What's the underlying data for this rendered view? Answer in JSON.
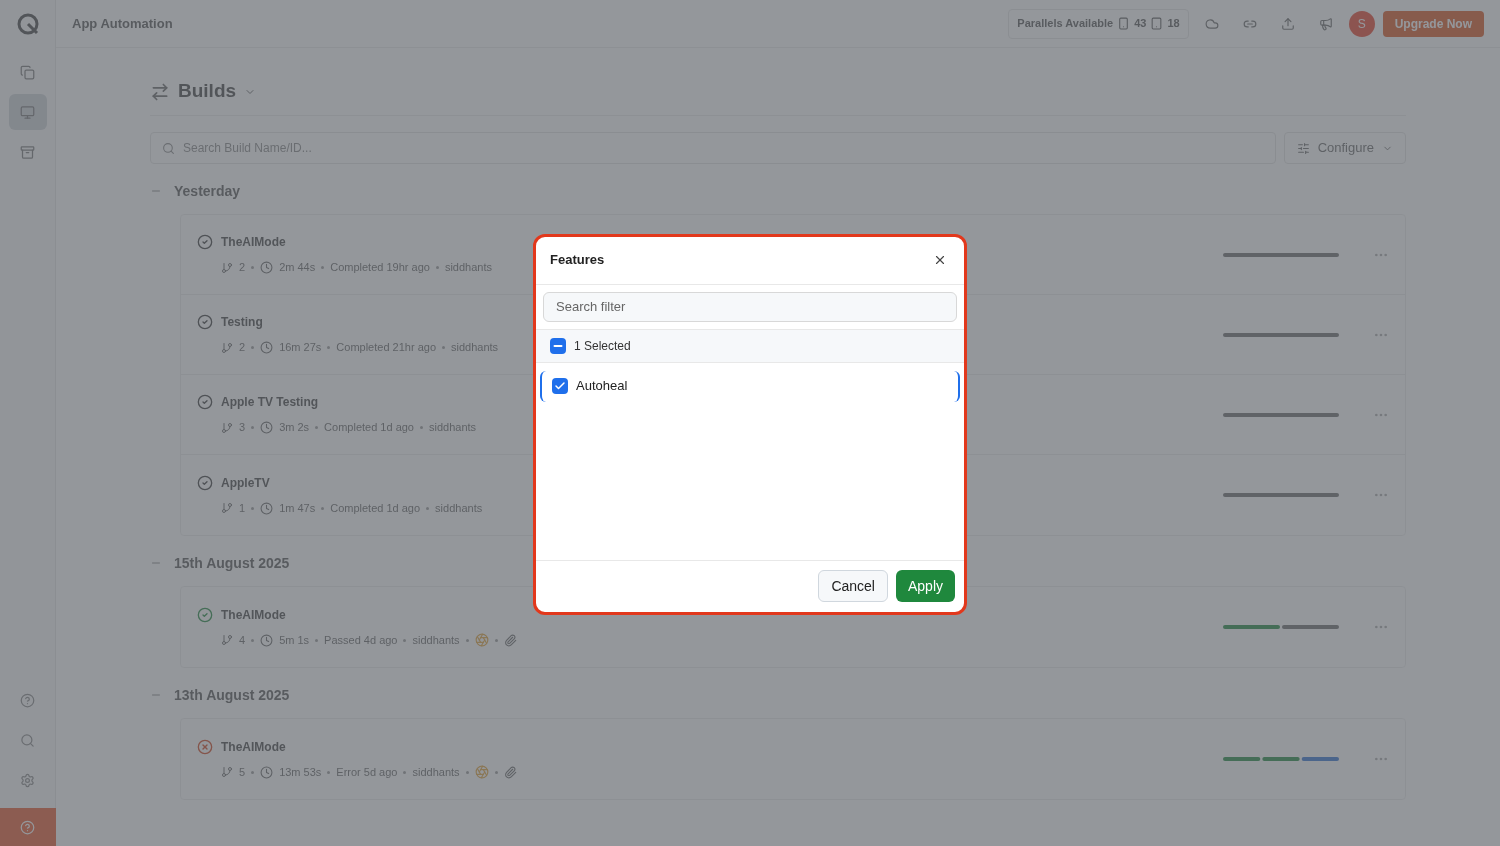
{
  "topbar": {
    "title": "App Automation",
    "parallels_label": "Parallels Available",
    "parallels_mobile": "43",
    "parallels_desktop": "18",
    "avatar": "S",
    "upgrade": "Upgrade Now"
  },
  "sidebar": {
    "items": [
      {
        "kind": "copy",
        "selected": false
      },
      {
        "kind": "device",
        "selected": true
      },
      {
        "kind": "archive",
        "selected": false
      }
    ],
    "bottom": [
      {
        "kind": "help"
      },
      {
        "kind": "search"
      },
      {
        "kind": "settings"
      }
    ]
  },
  "page": {
    "title": "Builds",
    "search": {
      "placeholder": "Search Build Name/ID..."
    },
    "configure": "Configure"
  },
  "groups": [
    {
      "label": "Yesterday",
      "builds": [
        {
          "name": "TheAIMode",
          "kind": "completed",
          "count": "2",
          "duration": "2m 44s",
          "result": "Completed 19hr ago",
          "user": "siddhants",
          "extras": false
        },
        {
          "name": "Testing",
          "kind": "completed",
          "count": "2",
          "duration": "16m 27s",
          "result": "Completed 21hr ago",
          "user": "siddhants",
          "extras": false
        },
        {
          "name": "Apple TV Testing",
          "kind": "completed",
          "count": "3",
          "duration": "3m 2s",
          "result": "Completed 1d ago",
          "user": "siddhants",
          "extras": false
        },
        {
          "name": "AppleTV",
          "kind": "completed",
          "count": "1",
          "duration": "1m 47s",
          "result": "Completed 1d ago",
          "user": "siddhants",
          "extras": false
        }
      ]
    },
    {
      "label": "15th August 2025",
      "builds": [
        {
          "name": "TheAIMode",
          "kind": "passed",
          "count": "4",
          "duration": "5m 1s",
          "result": "Passed 4d ago",
          "user": "siddhants",
          "extras": true
        }
      ]
    },
    {
      "label": "13th August 2025",
      "builds": [
        {
          "name": "TheAIMode",
          "kind": "error",
          "count": "5",
          "duration": "13m 53s",
          "result": "Error 5d ago",
          "user": "siddhants",
          "extras": true
        }
      ]
    }
  ],
  "dialog": {
    "title": "Features",
    "search": {
      "placeholder": "Search filter"
    },
    "select_all": {
      "label": "1 Selected",
      "indeterminate": true
    },
    "options": [
      {
        "label": "Autoheal",
        "checked": true,
        "focused": true
      }
    ],
    "buttons": [
      {
        "label": "Cancel",
        "kind": "secondary"
      },
      {
        "label": "Apply",
        "kind": "primary"
      }
    ]
  }
}
